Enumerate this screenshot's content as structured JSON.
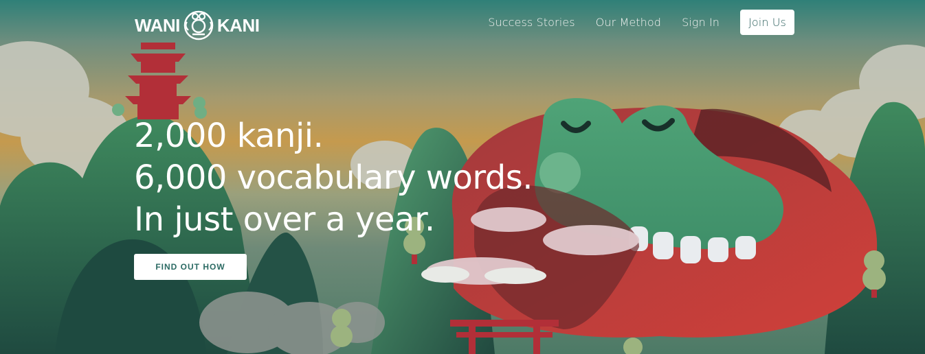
{
  "header": {
    "logo_left": "WANI",
    "logo_right": "KANI",
    "nav": {
      "success_stories": "Success Stories",
      "our_method": "Our Method",
      "sign_in": "Sign In",
      "join_us": "Join Us"
    }
  },
  "hero": {
    "line1": "2,000 kanji.",
    "line2": "6,000 vocabulary words.",
    "line3": "In just over a year.",
    "cta": "FIND OUT HOW"
  },
  "colors": {
    "teal_top": "#2f8078",
    "crab_green": "#4a9a72",
    "crab_red": "#b8343a",
    "button_text": "#2b6a63"
  }
}
